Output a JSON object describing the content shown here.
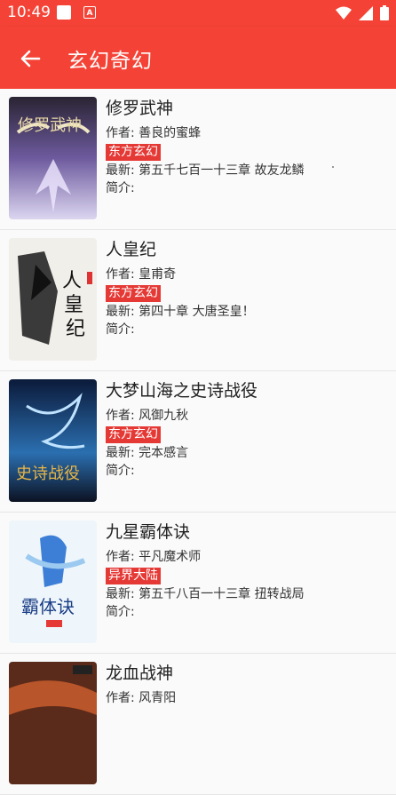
{
  "status_bar": {
    "time": "10:49"
  },
  "app_bar": {
    "title": "玄幻奇幻"
  },
  "labels": {
    "author": "作者: ",
    "latest": "最新: ",
    "intro": "简介:"
  },
  "books": [
    {
      "title": "修罗武神",
      "author": "善良的蜜蜂",
      "tag": "东方玄幻",
      "latest": "第五千七百一十三章 故友龙鳞",
      "intro": "",
      "cover": "cover-xiuluo"
    },
    {
      "title": "人皇纪",
      "author": "皇甫奇",
      "tag": "东方玄幻",
      "latest": "第四十章 大唐圣皇！",
      "intro": "",
      "cover": "cover-renhuang"
    },
    {
      "title": "大梦山海之史诗战役",
      "author": "风御九秋",
      "tag": "东方玄幻",
      "latest": "完本感言",
      "intro": "",
      "cover": "cover-shanhai"
    },
    {
      "title": "九星霸体诀",
      "author": "平凡魔术师",
      "tag": "异界大陆",
      "latest": "第五千八百一十三章 扭转战局",
      "intro": "",
      "cover": "cover-jiuxing"
    },
    {
      "title": "龙血战神",
      "author": "风青阳",
      "tag": "",
      "latest": "",
      "intro": "",
      "cover": "cover-longxue"
    }
  ]
}
